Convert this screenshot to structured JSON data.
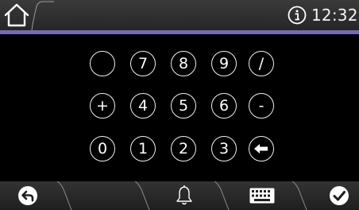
{
  "status_bar": {
    "time": "12:32",
    "home_icon": "home-icon",
    "info_icon": "info-icon"
  },
  "keypad": {
    "rows": [
      [
        "",
        "7",
        "8",
        "9",
        "/"
      ],
      [
        "+",
        "4",
        "5",
        "6",
        "-"
      ],
      [
        "0",
        "1",
        "2",
        "3",
        "backspace-icon"
      ]
    ]
  },
  "bottom_bar": {
    "back_icon": "back-arrow-icon",
    "bell_icon": "bell-icon",
    "keyboard_icon": "keyboard-icon",
    "confirm_icon": "checkmark-icon"
  },
  "colors": {
    "accent": "#7a68b8",
    "background": "#000000",
    "bar": "#2e2e2e"
  }
}
